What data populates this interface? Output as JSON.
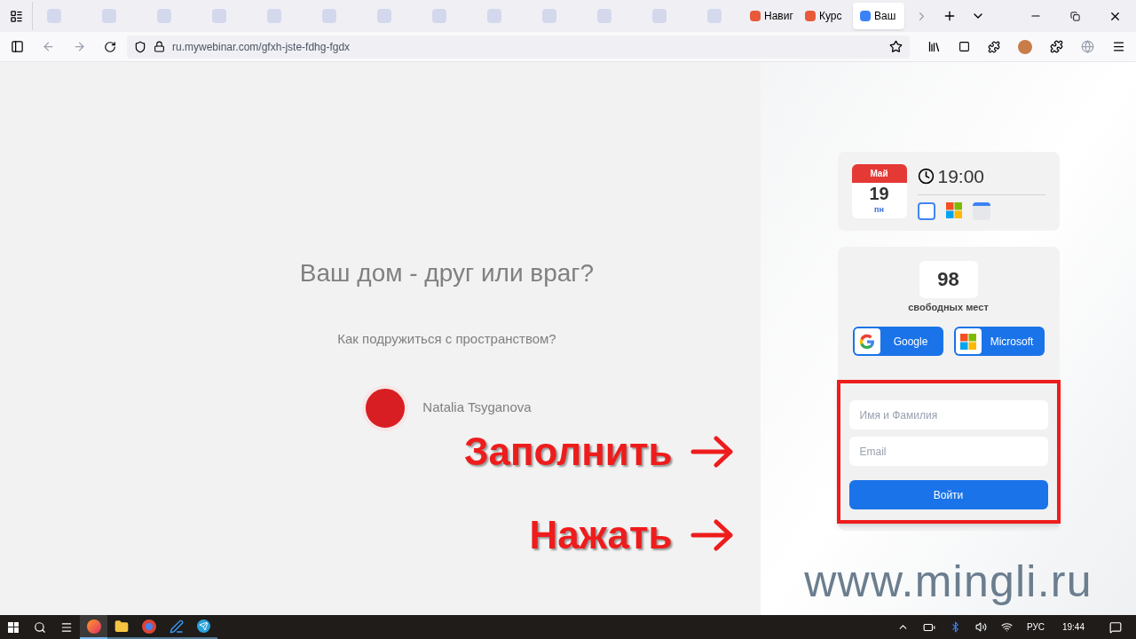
{
  "browser": {
    "tabs": [
      {
        "label": "Навиг",
        "selected": false,
        "color": "#e8583a"
      },
      {
        "label": "Курс",
        "selected": false,
        "color": "#e8583a"
      },
      {
        "label": "Ваш",
        "selected": true,
        "color": "#3b82f6"
      }
    ],
    "url": "ru.mywebinar.com/gfxh-jste-fdhg-fgdx"
  },
  "event": {
    "title": "Ваш дом - друг или враг?",
    "subtitle": "Как подружиться с пространством?",
    "host": "Natalia Tsyganova"
  },
  "schedule": {
    "month": "Май",
    "day": "19",
    "weekday": "пн",
    "time": "19:00"
  },
  "seats": {
    "count": "98",
    "label": "свободных мест"
  },
  "sign_in": [
    {
      "kind": "google",
      "label": "Google"
    },
    {
      "kind": "microsoft",
      "label": "Microsoft"
    }
  ],
  "form": {
    "fields": [
      {
        "placeholder": "Имя и Фамилия"
      },
      {
        "placeholder": "Email"
      }
    ],
    "submit": "Войти"
  },
  "annotations": [
    {
      "text": "Заполнить"
    },
    {
      "text": "Нажать"
    }
  ],
  "site": "www.mingli.ru",
  "taskbar": {
    "apps": [
      {
        "kind": "firefox",
        "selected": true
      },
      {
        "kind": "files",
        "selected": false
      },
      {
        "kind": "chrome",
        "selected": false
      },
      {
        "kind": "pen",
        "selected": false
      },
      {
        "kind": "telegram",
        "selected": false
      }
    ],
    "lang": "РУС",
    "time": "19:44"
  }
}
